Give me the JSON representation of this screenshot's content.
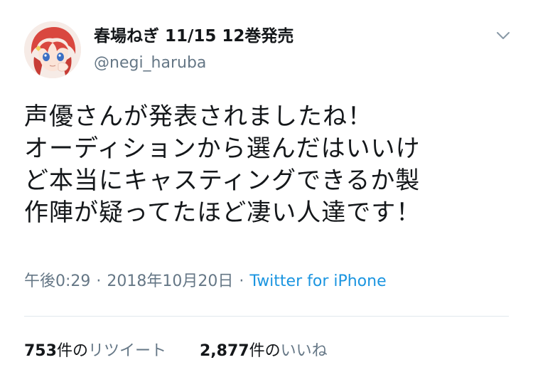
{
  "header": {
    "display_name": "春場ねぎ 11/15 12巻発売",
    "handle": "@negi_haruba"
  },
  "tweet": {
    "lines": [
      "声優さんが発表されましたね！",
      "オーディションから選んだはいいけ",
      "ど本当にキャスティングできるか製",
      "作陣が疑ってたほど凄い人達です！"
    ]
  },
  "meta": {
    "time": "午後0:29",
    "separator": "·",
    "date": "2018年10月20日",
    "source": "Twitter for iPhone"
  },
  "stats": {
    "retweets_count": "753",
    "retweets_unit": "件の",
    "retweets_label": "リツイート",
    "likes_count": "2,877",
    "likes_unit": "件の",
    "likes_label": "いいね"
  },
  "colors": {
    "link": "#1b95e0",
    "secondary_text": "#657786",
    "primary_text": "#14171a",
    "divider": "#e1e8ed"
  },
  "icons": {
    "menu": "chevron-down-icon"
  }
}
